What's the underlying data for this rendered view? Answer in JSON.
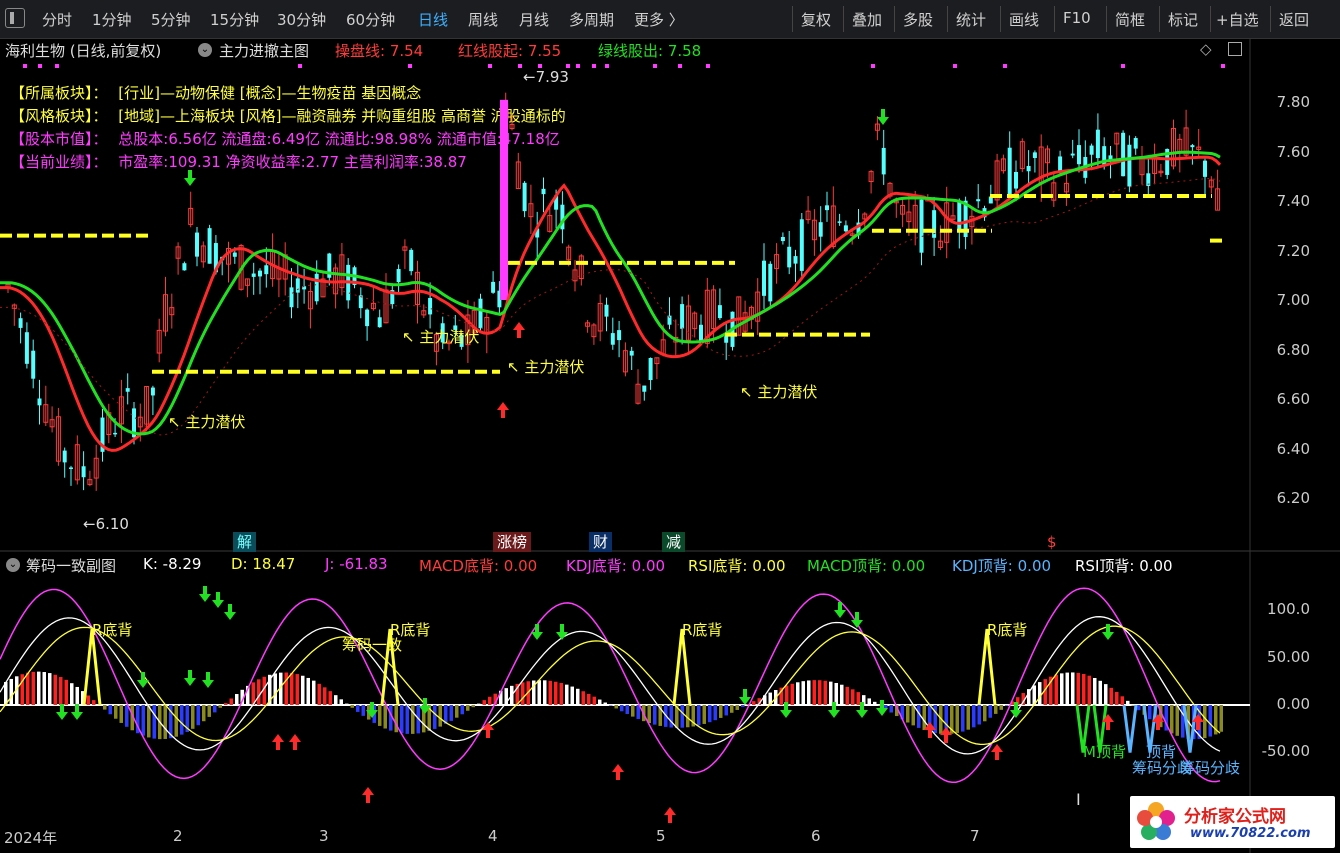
{
  "toolbar": {
    "periods": [
      "分时",
      "1分钟",
      "5分钟",
      "15分钟",
      "30分钟",
      "60分钟",
      "日线",
      "周线",
      "月线",
      "多周期",
      "更多 〉"
    ],
    "active_period": "日线",
    "actions": [
      "复权",
      "叠加",
      "多股",
      "统计",
      "画线",
      "F10",
      "简框",
      "标记",
      "+自选",
      "返回"
    ]
  },
  "main_chart": {
    "stock_title": "海利生物 (日线,前复权)",
    "indicator_name": "主力进撤主图",
    "indicators": [
      {
        "label": "操盘线: 7.54",
        "color": "#ff3b3b"
      },
      {
        "label": "红线股起: 7.55",
        "color": "#ff3b3b"
      },
      {
        "label": "绿线股出: 7.58",
        "color": "#22e022"
      }
    ],
    "info_lines": [
      {
        "label": "【所属板块】：",
        "text": "[行业]—动物保健 [概念]—生物疫苗 基因概念",
        "color": "#ffff3a"
      },
      {
        "label": "【风格板块】：",
        "text": "[地域]—上海板块 [风格]—融资融券 并购重组股 高商誉 沪股通标的",
        "color": "#ffff3a"
      },
      {
        "label": "【股本市值】：",
        "text": "总股本:6.56亿 流通盘:6.49亿 流通比:98.98% 流通市值:47.18亿",
        "color": "#ff3bff"
      },
      {
        "label": "【当前业绩】：",
        "text": "市盈率:109.31 净资收益率:2.77 主营利润率:38.87",
        "color": "#ff3bff"
      }
    ],
    "y_axis": [
      "7.80",
      "7.60",
      "7.40",
      "7.20",
      "7.00",
      "6.80",
      "6.60",
      "6.40",
      "6.20"
    ],
    "high_label": "←7.93",
    "low_label": "←6.10",
    "signal_labels": [
      "主力潜伏",
      "主力潜伏",
      "主力潜伏",
      "主力潜伏"
    ],
    "event_tags": [
      "解",
      "涨榜",
      "财",
      "减",
      "$"
    ]
  },
  "sub_chart": {
    "indicator_name": "筹码一致副图",
    "values": [
      {
        "label": "K: -8.29",
        "color": "#ffffff"
      },
      {
        "label": "D: 18.47",
        "color": "#ffff3a"
      },
      {
        "label": "J: -61.83",
        "color": "#ff3bff"
      },
      {
        "label": "MACD底背: 0.00",
        "color": "#ff3b3b"
      },
      {
        "label": "KDJ底背: 0.00",
        "color": "#ff3bff"
      },
      {
        "label": "RSI底背: 0.00",
        "color": "#ffff3a"
      },
      {
        "label": "MACD顶背: 0.00",
        "color": "#22e022"
      },
      {
        "label": "KDJ顶背: 0.00",
        "color": "#5ab4ff"
      },
      {
        "label": "RSI顶背: 0.00",
        "color": "#ffffff"
      }
    ],
    "y_axis": [
      "100.0",
      "50.00",
      "0.00",
      "-50.00"
    ],
    "annotations": [
      "R底背",
      "R底背",
      "R底背",
      "R底背",
      "筹码一致",
      "M顶背",
      "顶背",
      "筹码分歧",
      "筹码分歧"
    ]
  },
  "x_axis": {
    "months": [
      "2024年",
      "2",
      "3",
      "4",
      "5",
      "6",
      "7"
    ]
  },
  "watermark": {
    "title": "分析家公式网",
    "url": "www.70822.com"
  },
  "chart_data": {
    "type": "candlestick",
    "price_range": [
      6.1,
      7.93
    ],
    "annotated_high": 7.93,
    "annotated_low": 6.1,
    "support_levels": [
      7.26,
      6.71,
      7.15,
      6.86,
      7.28,
      7.42,
      7.24
    ],
    "current_values": {
      "操盘线": 7.54,
      "红线股起": 7.55,
      "绿线股出": 7.58,
      "K": -8.29,
      "D": 18.47,
      "J": -61.83
    }
  }
}
